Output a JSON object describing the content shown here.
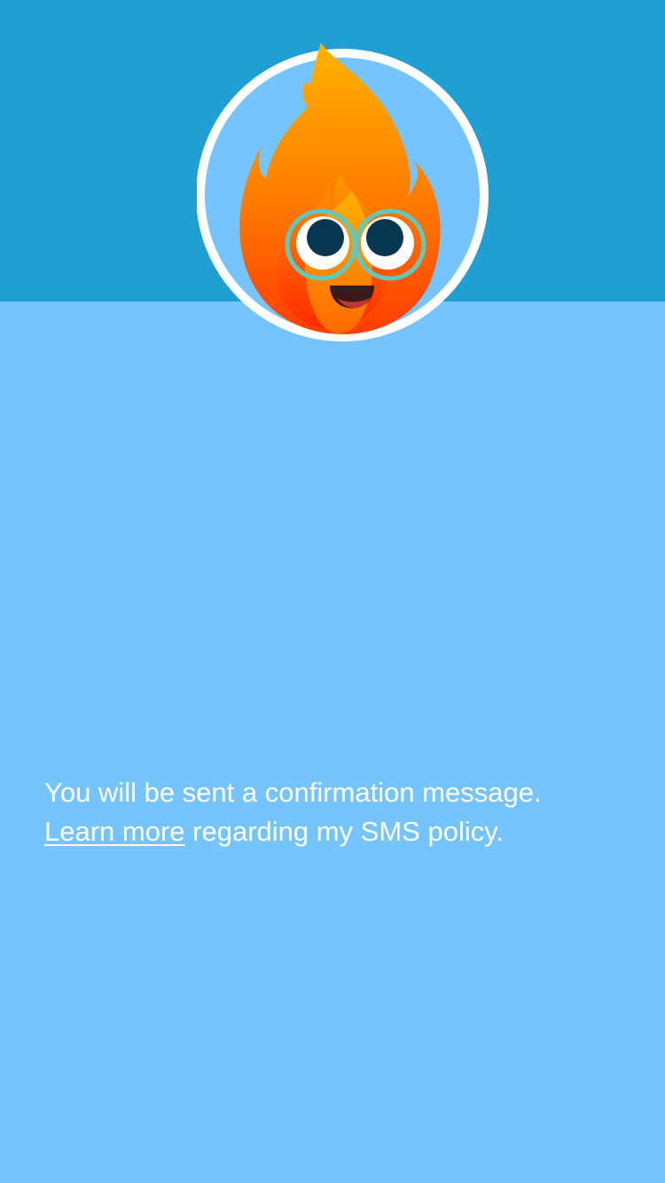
{
  "colors": {
    "header_band": "#1f9fd4",
    "background": "#76c4fd",
    "text": "#ffffff"
  },
  "avatar": {
    "icon": "fire-mascot-with-glasses-icon"
  },
  "confirmation": {
    "message": "You will be sent a confirmation message.",
    "link_text": "Learn more",
    "after_link": " regarding my SMS policy."
  }
}
